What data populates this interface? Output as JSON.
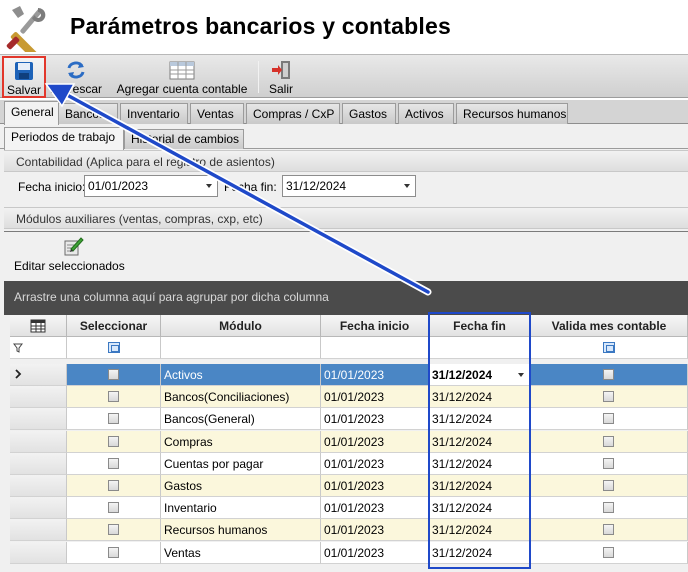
{
  "window": {
    "title": "Parámetros bancarios y contables"
  },
  "toolbar": {
    "save_label": "Salvar",
    "refresh_label": "Refrescar",
    "add_account_label": "Agregar cuenta contable",
    "exit_label": "Salir"
  },
  "main_tabs": [
    "General",
    "Bancos",
    "Inventario",
    "Ventas",
    "Compras / CxP",
    "Gastos",
    "Activos",
    "Recursos humanos"
  ],
  "sub_tabs": [
    "Periodos de trabajo",
    "Historial de cambios"
  ],
  "accounting": {
    "header": "Contabilidad (Aplica para el registro de asientos)",
    "start_label": "Fecha inicio:",
    "start_value": "01/01/2023",
    "end_label": "Fecha fin:",
    "end_value": "31/12/2024"
  },
  "modules_header": "Módulos auxiliares (ventas, compras, cxp, etc)",
  "edit_selected_label": "Editar seleccionados",
  "group_hint": "Arrastre una columna aquí para agrupar por dicha columna",
  "grid": {
    "columns": [
      "Seleccionar",
      "Módulo",
      "Fecha inicio",
      "Fecha fin",
      "Valida mes contable"
    ],
    "rows": [
      {
        "module": "Activos",
        "start": "01/01/2023",
        "end": "31/12/2024",
        "selected": true
      },
      {
        "module": "Bancos(Conciliaciones)",
        "start": "01/01/2023",
        "end": "31/12/2024"
      },
      {
        "module": "Bancos(General)",
        "start": "01/01/2023",
        "end": "31/12/2024"
      },
      {
        "module": "Compras",
        "start": "01/01/2023",
        "end": "31/12/2024"
      },
      {
        "module": "Cuentas por pagar",
        "start": "01/01/2023",
        "end": "31/12/2024"
      },
      {
        "module": "Gastos",
        "start": "01/01/2023",
        "end": "31/12/2024"
      },
      {
        "module": "Inventario",
        "start": "01/01/2023",
        "end": "31/12/2024"
      },
      {
        "module": "Recursos humanos",
        "start": "01/01/2023",
        "end": "31/12/2024"
      },
      {
        "module": "Ventas",
        "start": "01/01/2023",
        "end": "31/12/2024"
      }
    ]
  },
  "colors": {
    "accent_border": "#1f49c9",
    "save_highlight": "#e2372b",
    "selected_row": "#4a86c5",
    "alt_row": "#fbf7dc"
  }
}
